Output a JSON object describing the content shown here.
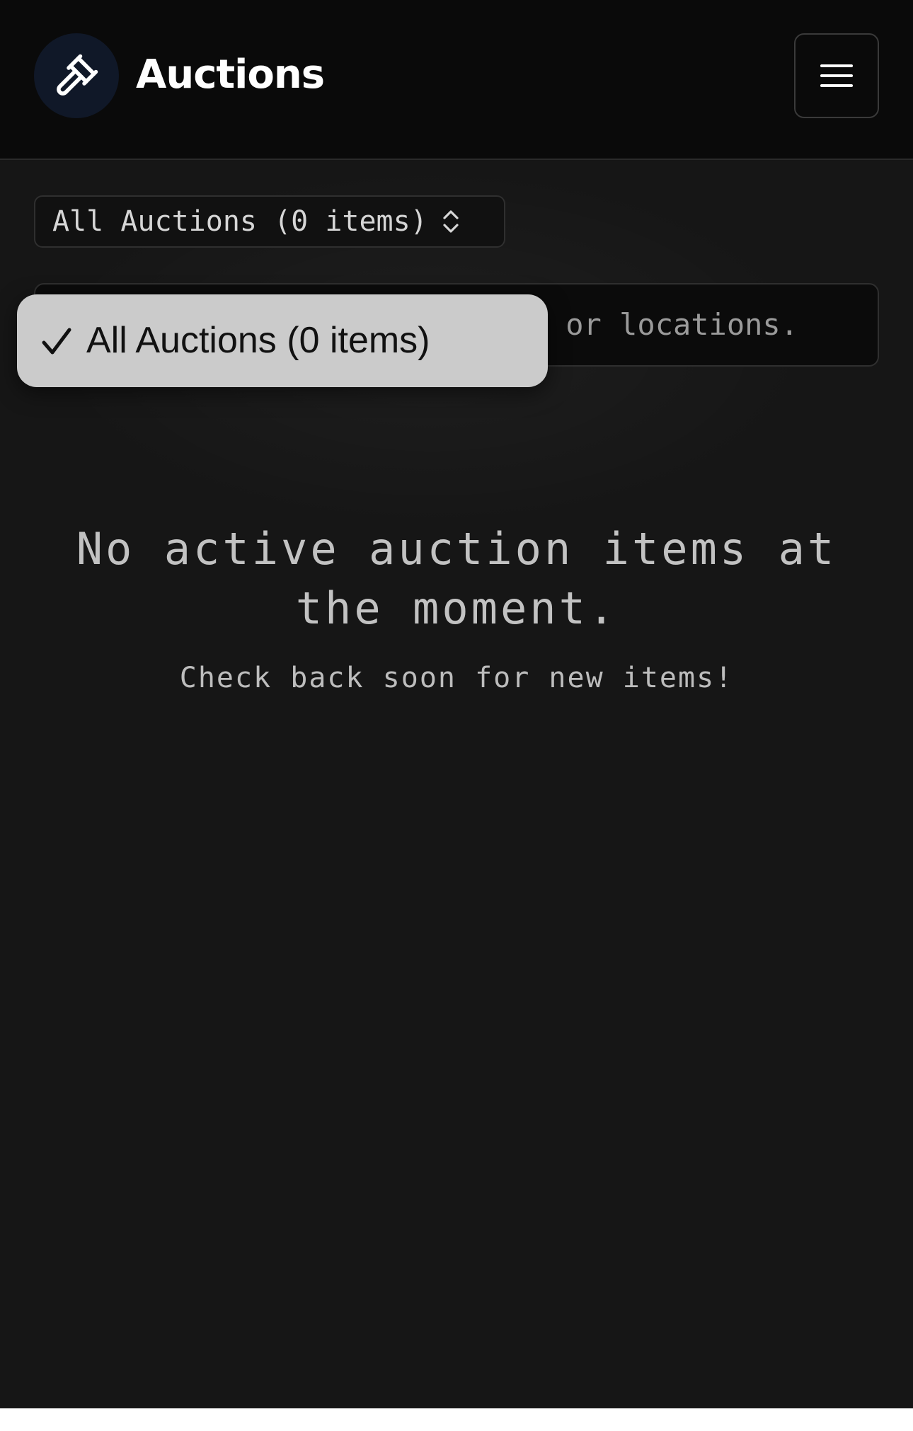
{
  "header": {
    "brand": "Auctions",
    "logo_icon": "gavel-icon",
    "menu_icon": "hamburger-menu-icon"
  },
  "filter": {
    "selected": "All Auctions (0 items)",
    "arrows_icon": "chevron-up-down-icon"
  },
  "search": {
    "visible_placeholder_fragment": "or locations."
  },
  "dropdown": {
    "options": [
      {
        "label": "All Auctions (0 items)",
        "checked": true
      }
    ]
  },
  "empty_state": {
    "title": "No active auction items at the moment.",
    "subtitle": "Check back soon for new items!"
  },
  "colors": {
    "background": "#161616",
    "header_bg": "#0a0a0a",
    "logo_circle": "#101828",
    "dropdown_bg": "#cbcbcb"
  }
}
